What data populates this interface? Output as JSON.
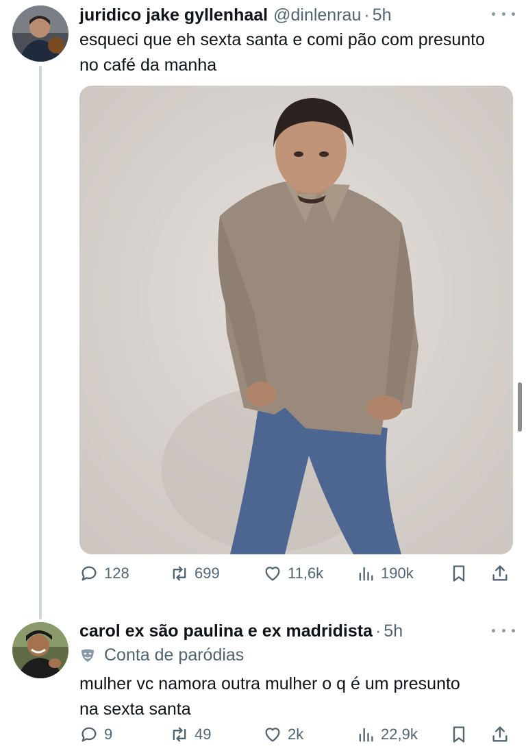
{
  "tweet1": {
    "name": "juridico jake gyllenhaal",
    "handle": "@dinlenrau",
    "dot": "·",
    "time": "5h",
    "text": "esqueci que eh sexta santa e comi pão com presunto no café da manha",
    "stats": {
      "replies": "128",
      "retweets": "699",
      "likes": "11,6k",
      "views": "190k"
    }
  },
  "tweet2": {
    "name": "carol ex são paulina e ex madridista",
    "dot": "·",
    "time": "5h",
    "label": "Conta de paródias",
    "text": "mulher vc namora outra mulher o q é um presunto na sexta santa",
    "stats": {
      "replies": "9",
      "retweets": "49",
      "likes": "2k",
      "views": "22,9k"
    }
  },
  "icons": {
    "reply": "reply-icon",
    "retweet": "retweet-icon",
    "like": "heart-icon",
    "views": "views-icon",
    "bookmark": "bookmark-icon",
    "share": "share-icon",
    "more": "more-icon",
    "parody": "parody-mask-icon"
  },
  "colors": {
    "text": "#0f1419",
    "secondary": "#536471",
    "thread_line": "#cfd9de"
  }
}
